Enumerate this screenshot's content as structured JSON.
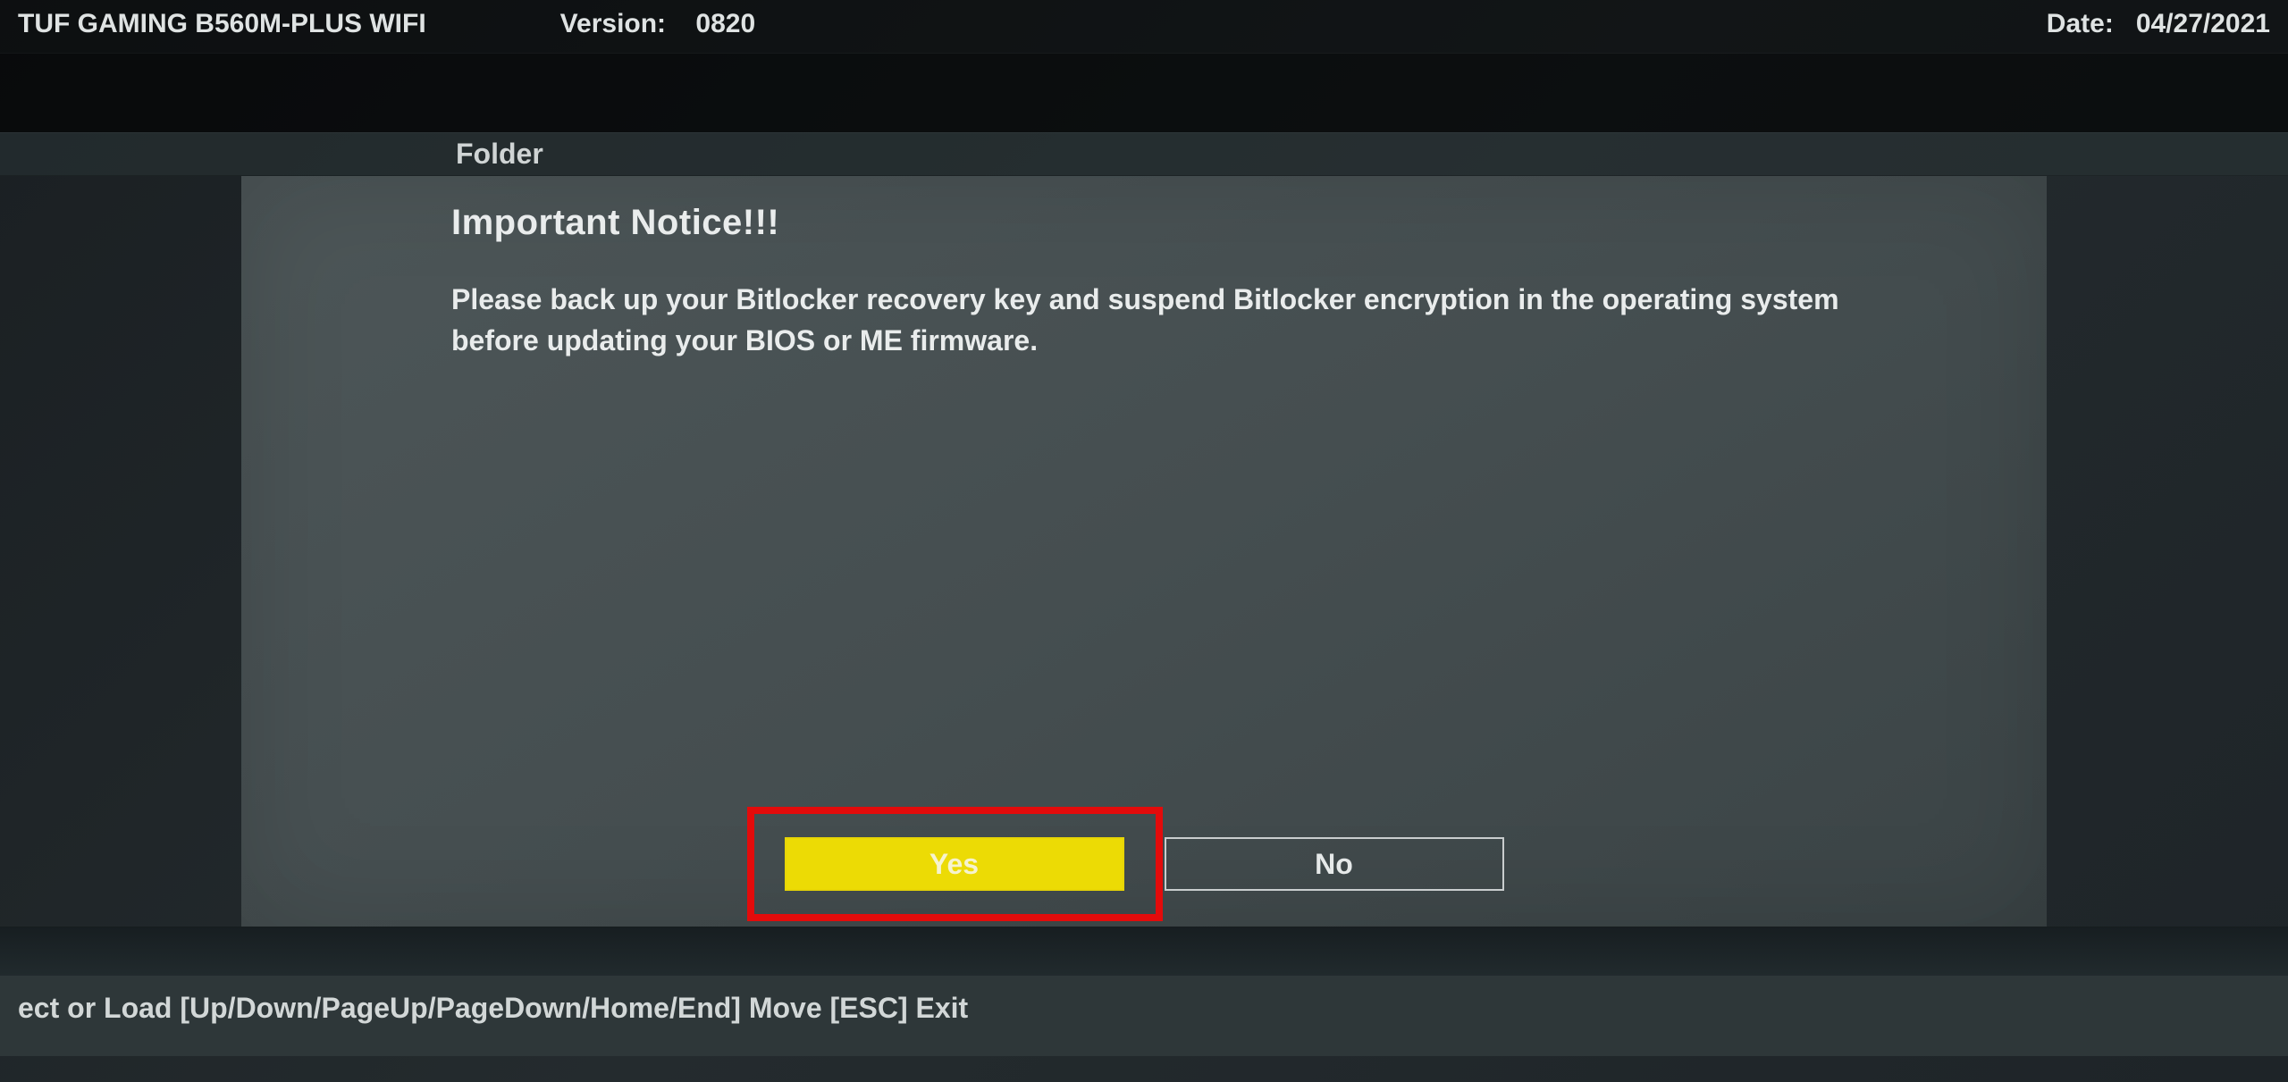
{
  "header": {
    "board": "TUF GAMING B560M-PLUS WIFI",
    "version_label": "Version:",
    "version_value": "0820",
    "date_label": "Date:",
    "date_value": "04/27/2021"
  },
  "folder_label": "Folder",
  "dialog": {
    "title": "Important Notice!!!",
    "body": "Please back up your Bitlocker recovery key and suspend Bitlocker encryption in the operating system before updating your BIOS or ME firmware.",
    "yes_label": "Yes",
    "no_label": "No"
  },
  "footer": {
    "hints": "ect or Load   [Up/Down/PageUp/PageDown/Home/End] Move   [ESC] Exit"
  }
}
